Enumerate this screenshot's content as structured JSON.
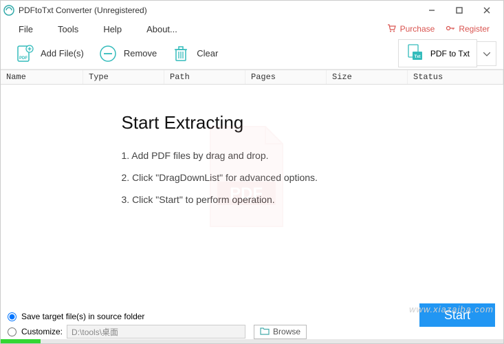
{
  "window": {
    "title": "PDFtoTxt Converter (Unregistered)"
  },
  "menu": {
    "file": "File",
    "tools": "Tools",
    "help": "Help",
    "about": "About..."
  },
  "rightLinks": {
    "purchase": "Purchase",
    "register": "Register"
  },
  "toolbar": {
    "addFiles": "Add File(s)",
    "remove": "Remove",
    "clear": "Clear",
    "mode": "PDF to Txt"
  },
  "columns": {
    "name": "Name",
    "type": "Type",
    "path": "Path",
    "pages": "Pages",
    "size": "Size",
    "status": "Status"
  },
  "main": {
    "heading": "Start Extracting",
    "step1": "1. Add PDF files by drag and drop.",
    "step2": "2. Click \"DragDownList\" for advanced options.",
    "step3": "3. Click \"Start\" to perform operation."
  },
  "bottom": {
    "saveInSource": "Save target file(s) in source folder",
    "customize": "Customize:",
    "path": "D:\\tools\\桌面",
    "browse": "Browse",
    "start": "Start"
  },
  "progress": {
    "percent": 8
  },
  "watermark": "www.xiazaiba.com"
}
